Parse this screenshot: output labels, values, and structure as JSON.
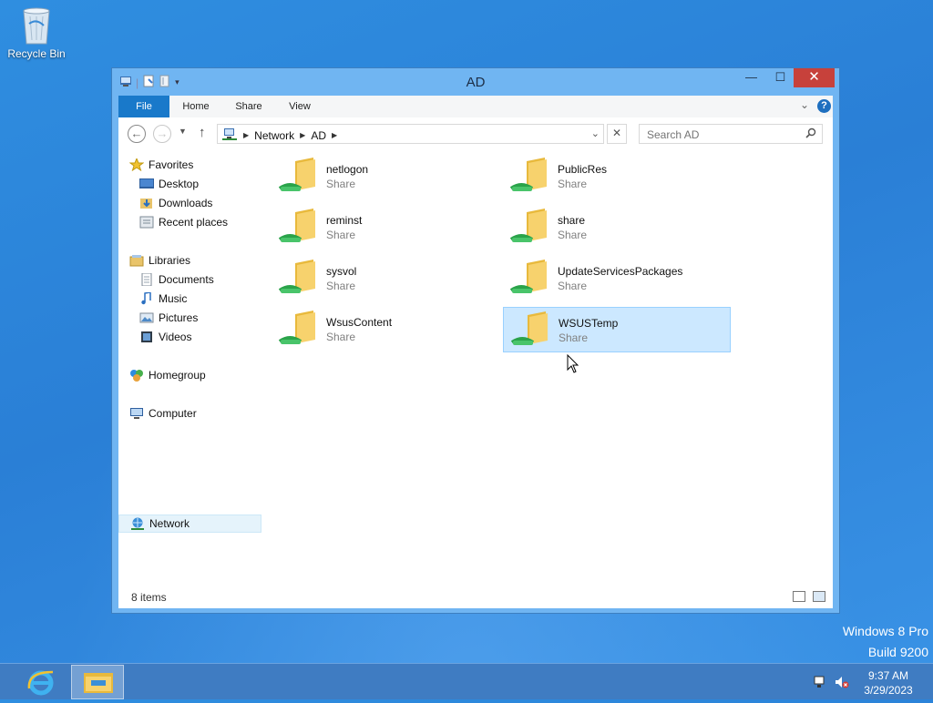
{
  "desktop": {
    "recycle_bin_label": "Recycle Bin",
    "watermark_line1": "Windows 8 Pro",
    "watermark_line2": "Build 9200"
  },
  "window": {
    "title": "AD",
    "ribbon_tabs": [
      "File",
      "Home",
      "Share",
      "View"
    ],
    "address_crumbs": [
      "Network",
      "AD"
    ],
    "search_placeholder": "Search AD"
  },
  "nav_pane": {
    "favorites": {
      "label": "Favorites",
      "items": [
        "Desktop",
        "Downloads",
        "Recent places"
      ]
    },
    "libraries": {
      "label": "Libraries",
      "items": [
        "Documents",
        "Music",
        "Pictures",
        "Videos"
      ]
    },
    "homegroup": "Homegroup",
    "computer": "Computer",
    "network": "Network"
  },
  "files": [
    {
      "name": "netlogon",
      "type": "Share",
      "selected": false
    },
    {
      "name": "PublicRes",
      "type": "Share",
      "selected": false
    },
    {
      "name": "reminst",
      "type": "Share",
      "selected": false
    },
    {
      "name": "share",
      "type": "Share",
      "selected": false
    },
    {
      "name": "sysvol",
      "type": "Share",
      "selected": false
    },
    {
      "name": "UpdateServicesPackages",
      "type": "Share",
      "selected": false
    },
    {
      "name": "WsusContent",
      "type": "Share",
      "selected": false
    },
    {
      "name": "WSUSTemp",
      "type": "Share",
      "selected": true
    }
  ],
  "status": {
    "item_count": "8 items"
  },
  "taskbar": {
    "time": "9:37 AM",
    "date": "3/29/2023"
  },
  "colors": {
    "accent": "#1979ca",
    "window_frame": "#70b5f2",
    "close_button": "#c7413b",
    "selection": "#cce8ff"
  }
}
